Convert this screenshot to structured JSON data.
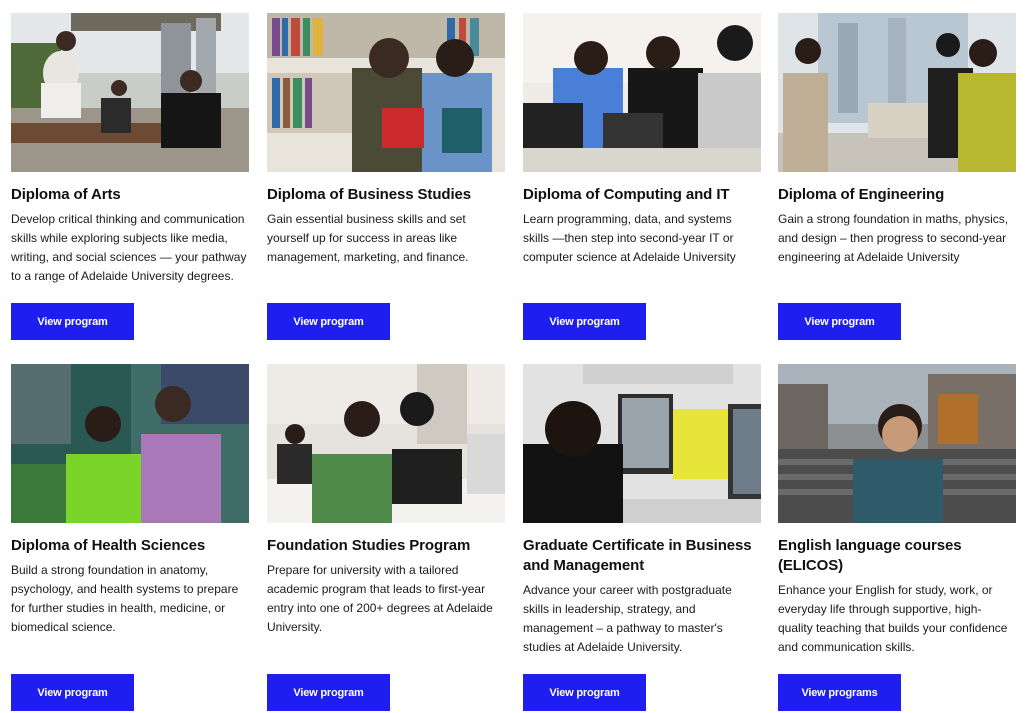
{
  "programs": [
    {
      "title": "Diploma of Arts",
      "description": "Develop critical thinking and communication skills while exploring subjects like media, writing, and social sciences — your pathway to a range of Adelaide University degrees.",
      "button": "View program",
      "image": "students-sitting-outdoors-photo"
    },
    {
      "title": "Diploma of Business Studies",
      "description": "Gain essential business skills and set yourself up for success in areas like management, marketing, and finance.",
      "button": "View program",
      "image": "students-holding-books-library-photo"
    },
    {
      "title": "Diploma of Computing and IT",
      "description": "Learn programming, data, and systems skills —then step into second-year IT or computer science at Adelaide University",
      "button": "View program",
      "image": "students-using-laptops-photo"
    },
    {
      "title": "Diploma of Engineering",
      "description": "Gain a strong foundation in maths, physics, and design – then progress to second-year engineering at Adelaide University",
      "button": "View program",
      "image": "students-building-model-photo"
    },
    {
      "title": "Diploma of Health Sciences",
      "description": "Build a strong foundation in anatomy, psychology, and health systems to prepare for further studies in health, medicine, or biomedical science.",
      "button": "View program",
      "image": "two-students-campus-photo"
    },
    {
      "title": "Foundation Studies Program",
      "description": "Prepare for university with a tailored academic program that  leads to first-year entry into one of 200+ degrees at Adelaide University.",
      "button": "View program",
      "image": "students-in-classroom-photo"
    },
    {
      "title": "Graduate Certificate in Business and Management",
      "description": "Advance your career with postgraduate skills in leadership, strategy, and management – a pathway to master's studies at Adelaide University.",
      "button": "View program",
      "image": "student-at-computer-lab-photo"
    },
    {
      "title": "English language courses (ELICOS)",
      "description": "Enhance your English for study, work, or everyday life through supportive, high-quality teaching that builds your confidence and communication skills.",
      "button": "View programs",
      "image": "student-portrait-city-photo"
    }
  ],
  "colors": {
    "button_bg": "#1e1ef0",
    "button_text": "#ffffff",
    "title_text": "#111111"
  }
}
